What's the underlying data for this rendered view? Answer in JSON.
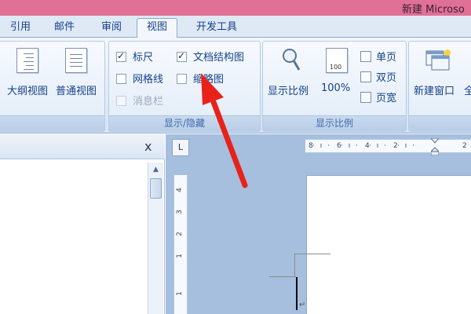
{
  "window": {
    "title": "新建 Microso"
  },
  "tabs": [
    {
      "label": "引用",
      "active": false
    },
    {
      "label": "邮件",
      "active": false
    },
    {
      "label": "审阅",
      "active": false
    },
    {
      "label": "视图",
      "active": true
    },
    {
      "label": "开发工具",
      "active": false
    }
  ],
  "views_group": {
    "outline_label": "大纲视图",
    "normal_label": "普通视图"
  },
  "show_hide_group": {
    "label": "显示/隐藏",
    "ruler": {
      "label": "标尺",
      "checked": true
    },
    "gridlines": {
      "label": "网格线",
      "checked": false
    },
    "message_bar": {
      "label": "消息栏",
      "checked": false,
      "disabled": true
    },
    "document_map": {
      "label": "文档结构图",
      "checked": true
    },
    "thumbnails": {
      "label": "缩略图",
      "checked": false
    }
  },
  "zoom_group": {
    "label": "显示比例",
    "zoom_label": "显示比例",
    "hundred_label": "100%",
    "one_page_label": "单页",
    "two_pages_label": "双页",
    "page_width_label": "页宽",
    "page_icon_text": "100"
  },
  "window_group": {
    "new_window_label": "新建窗口",
    "arrange_all_label": "全"
  },
  "nav_pane": {
    "close_label": "x"
  },
  "ruler": {
    "corner_label": "L",
    "h_ticks": [
      "8",
      "6",
      "4",
      "2",
      "2"
    ],
    "v_ticks": [
      "4",
      "3",
      "2",
      "1",
      "1"
    ]
  },
  "colors": {
    "title_bar": "#e07096",
    "ribbon_bg": "#dfe9f5",
    "annotation_arrow": "#e8221b"
  }
}
